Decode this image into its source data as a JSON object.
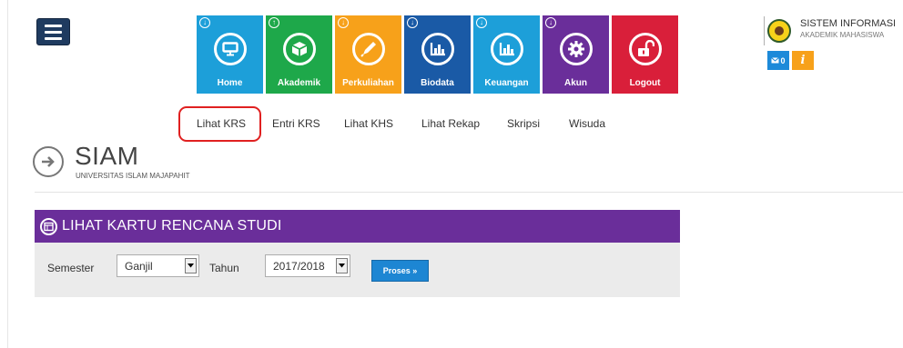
{
  "tiles": [
    {
      "label": "Home",
      "color": "#1d9fd9",
      "icon": "monitor-icon"
    },
    {
      "label": "Akademik",
      "color": "#1ea84a",
      "icon": "cube-icon"
    },
    {
      "label": "Perkuliahan",
      "color": "#f7a11a",
      "icon": "pencil-icon"
    },
    {
      "label": "Biodata",
      "color": "#1a5aa6",
      "icon": "bar-chart-icon"
    },
    {
      "label": "Keuangan",
      "color": "#1d9fd9",
      "icon": "bar-chart-icon"
    },
    {
      "label": "Akun",
      "color": "#6a2e9a",
      "icon": "gear-icon"
    },
    {
      "label": "Logout",
      "color": "#d91f3a",
      "icon": "unlock-icon"
    }
  ],
  "brand": {
    "title": "SISTEM INFORMASI",
    "subtitle": "AKADEMIK MAHASISWA"
  },
  "badges": {
    "mail_count": "0",
    "info_glyph": "i"
  },
  "subnav": [
    "Lihat KRS",
    "Entri KRS",
    "Lihat KHS",
    "Lihat Rekap",
    "Skripsi",
    "Wisuda"
  ],
  "site": {
    "title": "SIAM",
    "subtitle": "UNIVERSITAS ISLAM MAJAPAHIT"
  },
  "panel": {
    "title": "LIHAT KARTU RENCANA STUDI",
    "semester_label": "Semester",
    "semester_value": "Ganjil",
    "tahun_label": "Tahun",
    "tahun_value": "2017/2018",
    "submit_label": "Proses »"
  },
  "colors": {
    "header_purple": "#6a2e9a",
    "highlight_red": "#e02020",
    "button_blue": "#1d86d3"
  }
}
